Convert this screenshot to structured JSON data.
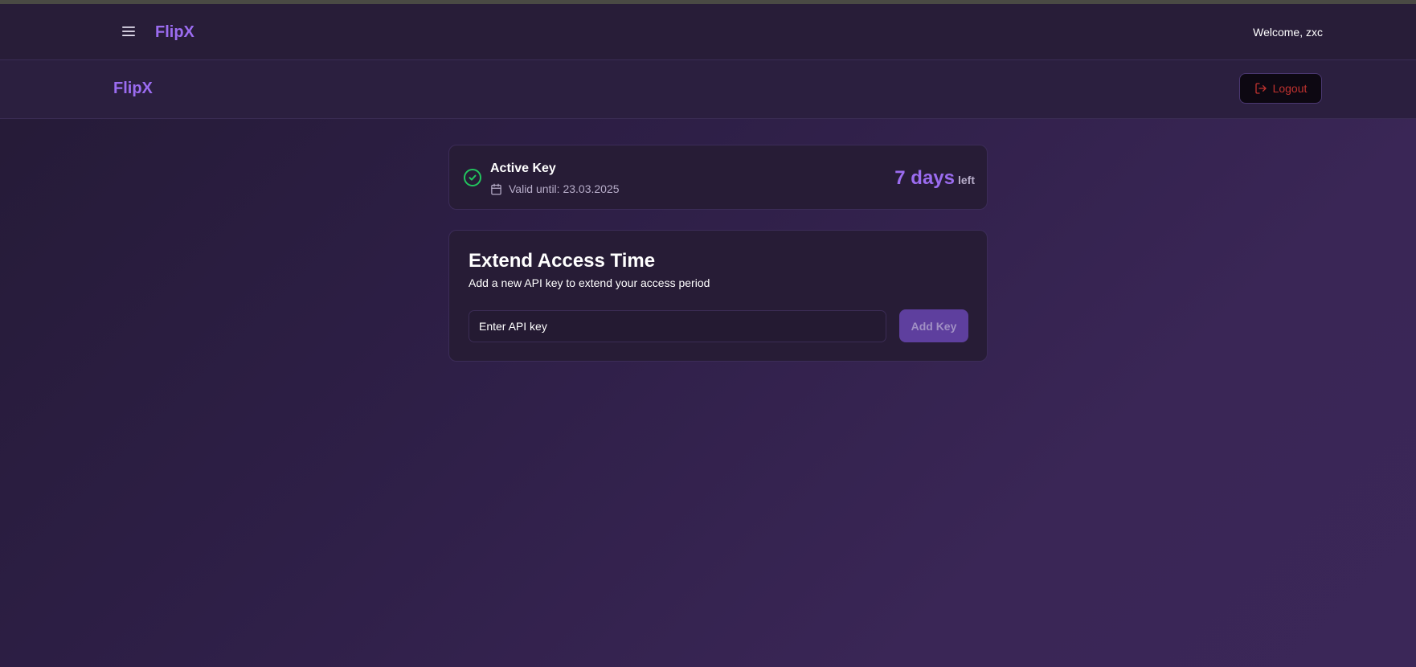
{
  "colors": {
    "accent": "#9b6cf0",
    "success": "#22c55e",
    "danger": "#c0322f",
    "background": "#2e1f47",
    "card": "#271c36",
    "button": "#5e3f9e"
  },
  "topbar": {
    "menu_icon": "hamburger-menu-icon",
    "brand": "FlipX",
    "welcome": "Welcome, zxc"
  },
  "subheader": {
    "brand": "FlipX",
    "logout_icon": "logout-icon",
    "logout_label": "Logout"
  },
  "active_key": {
    "status_icon": "check-circle-icon",
    "title": "Active Key",
    "calendar_icon": "calendar-icon",
    "valid_until": "Valid until: 23.03.2025",
    "days_value": "7 days",
    "days_suffix": "left"
  },
  "extend": {
    "title": "Extend Access Time",
    "subtitle": "Add a new API key to extend your access period",
    "input_placeholder": "Enter API key",
    "input_value": "",
    "button_label": "Add Key"
  }
}
